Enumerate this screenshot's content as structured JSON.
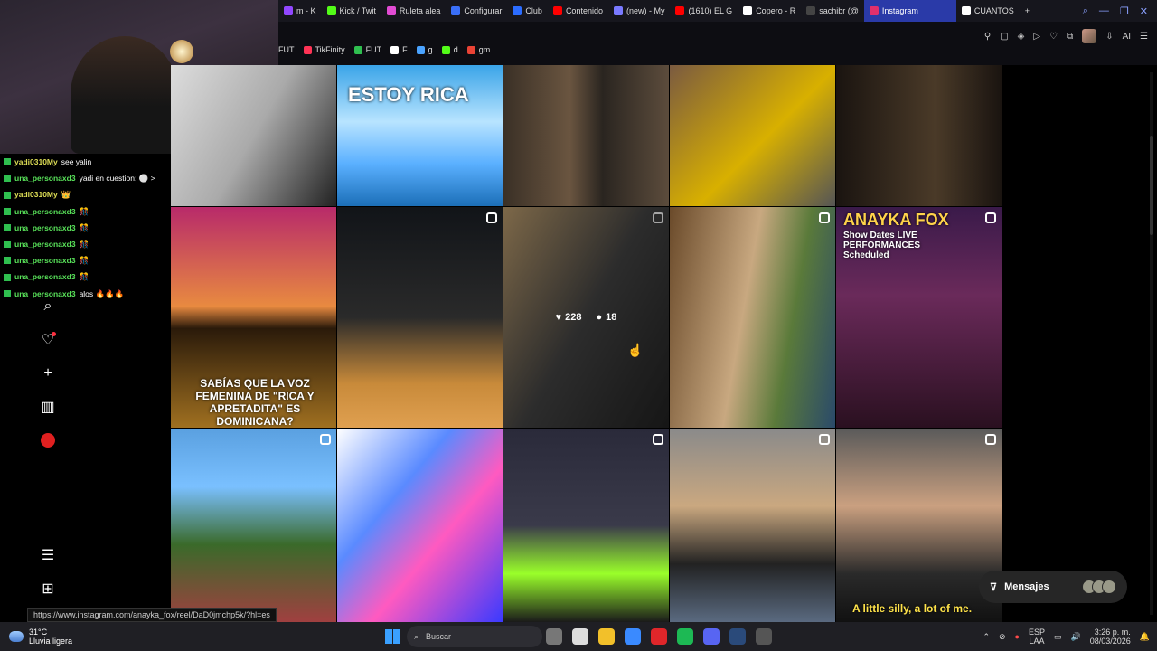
{
  "browser": {
    "tabs": [
      {
        "label": "m - K",
        "color": "#9147ff"
      },
      {
        "label": "Kick / Twit",
        "color": "#53fc18"
      },
      {
        "label": "Ruleta alea",
        "color": "#e24bd3"
      },
      {
        "label": "Configurar",
        "color": "#3a6ff7"
      },
      {
        "label": "Club",
        "color": "#2b6cff"
      },
      {
        "label": "Contenido",
        "color": "#ff0000"
      },
      {
        "label": "(new) - My",
        "color": "#7a7aff"
      },
      {
        "label": "(1610) EL G",
        "color": "#ff0000"
      },
      {
        "label": "Copero - R",
        "color": "#ffffff"
      },
      {
        "label": "sachibr (@",
        "color": "#111111"
      },
      {
        "label": "Instagram",
        "color": "#e1306c",
        "active": true
      },
      {
        "label": "CUANTOS",
        "color": "#ffffff"
      }
    ],
    "new_tab": "+",
    "bookmarks": [
      {
        "label": "FUT",
        "color": "#333"
      },
      {
        "label": "TikFinity",
        "color": "#ff3355"
      },
      {
        "label": "FUT",
        "color": "#2fbf4f"
      },
      {
        "label": "F",
        "color": "#ffffff"
      },
      {
        "label": "g",
        "color": "#4aa3ff"
      },
      {
        "label": "d",
        "color": "#53fc18"
      },
      {
        "label": "gm",
        "color": "#ea4335"
      }
    ],
    "toolbar_ai": "AI"
  },
  "chat": [
    {
      "user": "yadi0310My",
      "text": "see yalin",
      "color": "yellow"
    },
    {
      "user": "una_personaxd3",
      "text": "yadi en cuestion: ⚪ >",
      "color": "green"
    },
    {
      "user": "yadi0310My",
      "text": "👑",
      "color": "yellow"
    },
    {
      "user": "una_personaxd3",
      "text": "🎊",
      "color": "green"
    },
    {
      "user": "una_personaxd3",
      "text": "🎊",
      "color": "green"
    },
    {
      "user": "una_personaxd3",
      "text": "🎊",
      "color": "green"
    },
    {
      "user": "una_personaxd3",
      "text": "🎊",
      "color": "green"
    },
    {
      "user": "una_personaxd3",
      "text": "🎊",
      "color": "green"
    },
    {
      "user": "una_personaxd3",
      "text": "alos 🔥🔥🔥",
      "color": "green"
    }
  ],
  "ig_nav": {
    "search": "⌕",
    "notifications": "♡",
    "create": "+",
    "dashboard": "▥",
    "more": "☰",
    "meta": "⊞"
  },
  "grid": {
    "posts": [
      {
        "caption": "ESTOY RICA"
      },
      {
        "caption": "SABÍAS QUE LA VOZ FEMENINA DE \"RICA Y APRETADITA\" ES DOMINICANA?"
      },
      {
        "caption": "ANAYKA FOX"
      },
      {
        "caption": "Show Dates LIVE PERFORMANCES Scheduled"
      },
      {
        "caption": "A little silly, a lot of me."
      }
    ],
    "hover": {
      "likes": "228",
      "comments": "18"
    }
  },
  "messages": {
    "label": "Mensajes"
  },
  "status_url": "https://www.instagram.com/anayka_fox/reel/DaD0jmchp5k/?hl=es",
  "taskbar": {
    "temp": "31°C",
    "weather": "Lluvia ligera",
    "search_placeholder": "Buscar",
    "lang1": "ESP",
    "lang2": "LAA",
    "time": "3:26 p. m.",
    "date": "08/03/2026"
  }
}
